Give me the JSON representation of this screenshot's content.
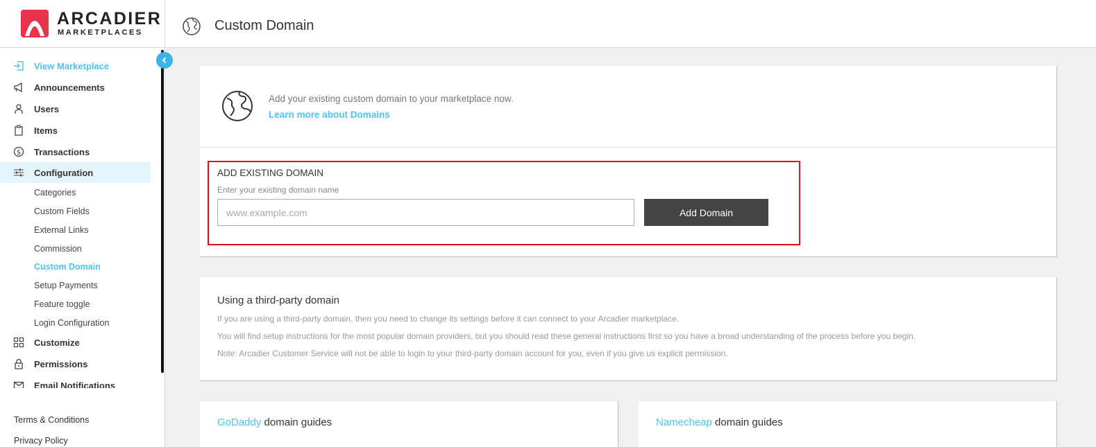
{
  "brand": {
    "name": "ARCADIER",
    "sub": "MARKETPLACES",
    "color": "#e8334a"
  },
  "header": {
    "title": "Custom Domain",
    "icon": "globe-icon"
  },
  "sidebar": {
    "items": [
      {
        "label": "View Marketplace",
        "icon": "login-arrow-icon"
      },
      {
        "label": "Announcements",
        "icon": "megaphone-icon"
      },
      {
        "label": "Users",
        "icon": "user-icon"
      },
      {
        "label": "Items",
        "icon": "clipboard-icon"
      },
      {
        "label": "Transactions",
        "icon": "dollar-circle-icon"
      },
      {
        "label": "Configuration",
        "icon": "sliders-icon"
      }
    ],
    "sub_items": [
      "Categories",
      "Custom Fields",
      "External Links",
      "Commission",
      "Custom Domain",
      "Setup Payments",
      "Feature toggle",
      "Login Configuration"
    ],
    "items_after": [
      {
        "label": "Customize",
        "icon": "grid-icon"
      },
      {
        "label": "Permissions",
        "icon": "lock-icon"
      },
      {
        "label": "Email Notifications",
        "icon": "envelope-icon"
      }
    ],
    "footer": [
      "Terms & Conditions",
      "Privacy Policy"
    ]
  },
  "intro": {
    "text": "Add your existing custom domain to your marketplace now.",
    "link": "Learn more about Domains"
  },
  "add_domain": {
    "title": "ADD EXISTING DOMAIN",
    "help": "Enter your existing domain name",
    "placeholder": "www.example.com",
    "value": "",
    "button": "Add Domain"
  },
  "third_party": {
    "title": "Using a third-party domain",
    "lines": [
      "If you are using a third-party domain, then you need to change its settings before it can connect to your Arcadier marketplace.",
      "You will find setup instructions for the most popular domain providers, but you should read these general instructions first so you have a broad understanding of the process before you begin.",
      "Note: Arcadier Customer Service will not be able to login to your third-party domain account for you, even if you give us explicit permission."
    ]
  },
  "guides": [
    {
      "brand": "GoDaddy",
      "suffix": " domain guides"
    },
    {
      "brand": "Namecheap",
      "suffix": " domain guides"
    }
  ],
  "colors": {
    "accent": "#4fc3ef",
    "highlight_border": "#e30d1a",
    "button_bg": "#444444"
  }
}
